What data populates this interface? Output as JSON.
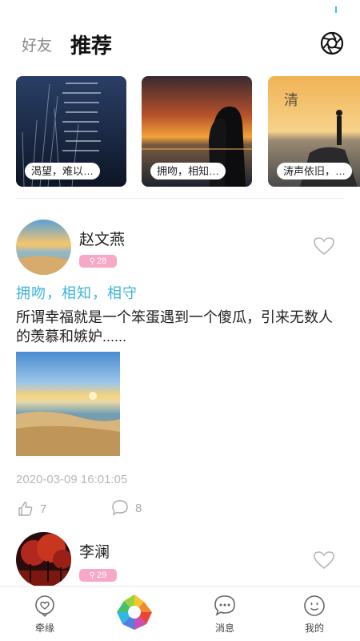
{
  "header": {
    "tab_friends": "好友",
    "tab_recommend": "推荐",
    "camera_icon": "camera-shutter-icon"
  },
  "topics": [
    {
      "label": "渴望，难以…"
    },
    {
      "label": "拥吻，相知…"
    },
    {
      "label": "涛声依旧，…"
    }
  ],
  "posts": [
    {
      "username": "赵文燕",
      "badge": "28",
      "tags": "拥吻，相知，相守",
      "text": "所谓幸福就是一个笨蛋遇到一个傻瓜，引来无数人的羡慕和嫉妒......",
      "timestamp": "2020-03-09 16:01:05",
      "likes": "7",
      "comments": "8"
    },
    {
      "username": "李澜",
      "badge": "29"
    }
  ],
  "bottom_nav": {
    "items": [
      {
        "label": "牵缘",
        "icon": "location-heart-icon"
      },
      {
        "label": "",
        "icon": "aperture-icon"
      },
      {
        "label": "消息",
        "icon": "message-bubble-icon"
      },
      {
        "label": "我的",
        "icon": "smiley-profile-icon"
      }
    ]
  },
  "colors": {
    "accent_blue": "#3cb4d8",
    "badge_pink": "#f6a8c6",
    "muted_gray": "#b8b8b8"
  }
}
